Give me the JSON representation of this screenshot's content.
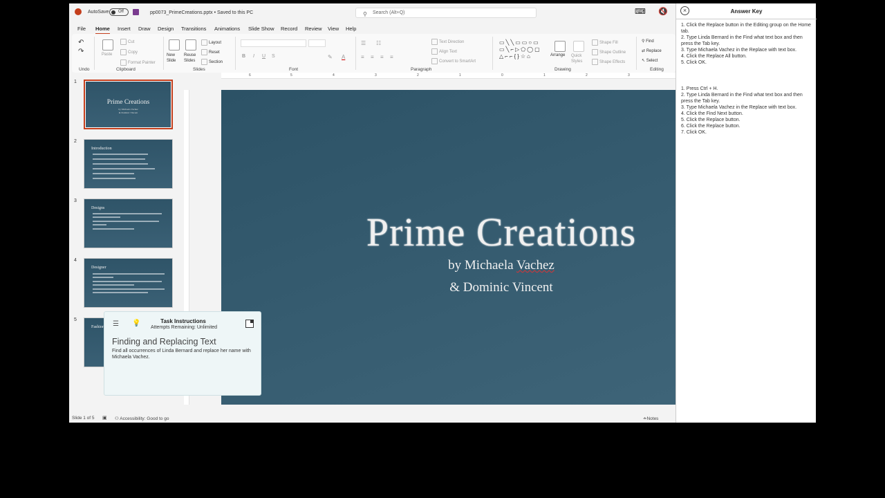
{
  "titlebar": {
    "autosave_label": "AutoSave",
    "autosave_state": "Off",
    "filename": "pp0073_PrimeCreations.pptx • Saved to this PC",
    "search_placeholder": "Search (Alt+Q)"
  },
  "menu": [
    "File",
    "Home",
    "Insert",
    "Draw",
    "Design",
    "Transitions",
    "Animations",
    "Slide Show",
    "Record",
    "Review",
    "View",
    "Help"
  ],
  "ribbon": {
    "undo": "Undo",
    "clipboard": {
      "label": "Clipboard",
      "paste": "Paste",
      "cut": "Cut",
      "copy": "Copy",
      "format_painter": "Format Painter"
    },
    "slides": {
      "label": "Slides",
      "new_slide": "New Slide",
      "reuse": "Reuse Slides",
      "layout": "Layout",
      "reset": "Reset",
      "section": "Section"
    },
    "font": {
      "label": "Font"
    },
    "paragraph": {
      "label": "Paragraph",
      "text_direction": "Text Direction",
      "align_text": "Align Text",
      "smartart": "Convert to SmartArt"
    },
    "drawing": {
      "label": "Drawing",
      "arrange": "Arrange",
      "quick_styles": "Quick Styles",
      "fill": "Shape Fill",
      "outline": "Shape Outline",
      "effects": "Shape Effects"
    },
    "editing": {
      "label": "Editing",
      "find": "Find",
      "replace": "Replace",
      "select": "Select"
    }
  },
  "thumbnails": [
    {
      "num": "1",
      "title": "Prime Creations",
      "sub1": "by Michaela Vachez",
      "sub2": "& Dominic Vincent"
    },
    {
      "num": "2",
      "title": "Introduction"
    },
    {
      "num": "3",
      "title": "Designs"
    },
    {
      "num": "4",
      "title": "Designer"
    },
    {
      "num": "5",
      "title": "Fashion"
    }
  ],
  "ruler": [
    "6",
    "5",
    "4",
    "3",
    "2",
    "1",
    "0",
    "1",
    "2",
    "3"
  ],
  "slide": {
    "title": "Prime Creations",
    "sub_prefix": "by Michaela ",
    "sub_surname": "Vachez",
    "sub2": "& Dominic Vincent"
  },
  "status": {
    "slide_of": "Slide 1 of 5",
    "accessibility": "Accessibility: Good to go",
    "notes": "Notes"
  },
  "task": {
    "header": "Task Instructions",
    "attempts": "Attempts Remaining: Unlimited",
    "title": "Finding and Replacing Text",
    "description": "Find all occurrences of Linda Bernard and replace her name with Michaela Vachez."
  },
  "answer_key": {
    "title": "Answer Key",
    "method1": [
      "1. Click the Replace button in the Editing group on the Home tab.",
      "2. Type Linda Bernard in the Find what text box and then press the Tab key.",
      "3. Type Michaela Vachez in the Replace with text box.",
      "4. Click the Replace All button.",
      "5. Click OK."
    ],
    "method2": [
      "1. Press Ctrl + H.",
      "2. Type Linda Bernard in the Find what text box and then press the Tab key.",
      "3. Type Michaela Vachez in the Replace with text box.",
      "4. Click the Find Next button.",
      "5. Click the Replace button.",
      "6. Click the Replace button.",
      "7. Click OK."
    ]
  }
}
